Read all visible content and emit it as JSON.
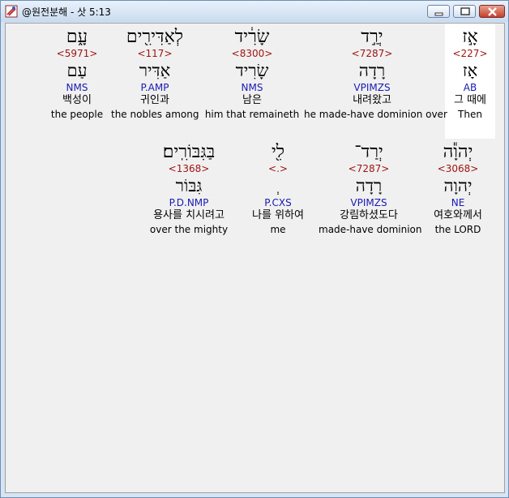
{
  "window": {
    "title": "@원전분해 - 삿 5:13"
  },
  "row1": [
    {
      "heb": "אָ֣ז",
      "strong": "<227>",
      "lemma": "אָז",
      "morph": "AB",
      "kor": "그 때에",
      "eng": "Then"
    },
    {
      "heb": "יְרַ֣ד",
      "strong": "<7287>",
      "lemma": "רָדָה",
      "morph": "VPIMZS",
      "kor": "내려왔고",
      "eng": "he made-have dominion over"
    },
    {
      "heb": "שָׂרִ֔יד",
      "strong": "<8300>",
      "lemma": "שָׂרִיד",
      "morph": "NMS",
      "kor": "남은",
      "eng": "him that remaineth"
    },
    {
      "heb": "לְאַדִּירִ֖ים",
      "strong": "<117>",
      "lemma": "אַדִּיר",
      "morph": "P.AMP",
      "kor": "귀인과",
      "eng": "the nobles among"
    },
    {
      "heb": "עָ֑ם",
      "strong": "<5971>",
      "lemma": "עַם",
      "morph": "NMS",
      "kor": "백성이",
      "eng": "the people"
    }
  ],
  "row2": [
    {
      "heb": "יְהוָ֕ה",
      "strong": "<3068>",
      "lemma": "יְהוָה",
      "morph": "NE",
      "kor": "여호와께서",
      "eng": "the LORD"
    },
    {
      "heb": "יְרַד־",
      "strong": "<7287>",
      "lemma": "רָדָה",
      "morph": "VPIMZS",
      "kor": "강림하셨도다",
      "eng": "made-have dominion"
    },
    {
      "heb": "לִ֖י",
      "strong": "<.>",
      "lemma": "ְ",
      "morph": "P.CXS",
      "kor": "나를 위하여",
      "eng": "me"
    },
    {
      "heb": "בַּגִּבּוֹרִֽים׃",
      "strong": "<1368>",
      "lemma": "גִּבּוֹר",
      "morph": "P.D.NMP",
      "kor": "용사를 치시려고",
      "eng": "over the mighty"
    }
  ]
}
